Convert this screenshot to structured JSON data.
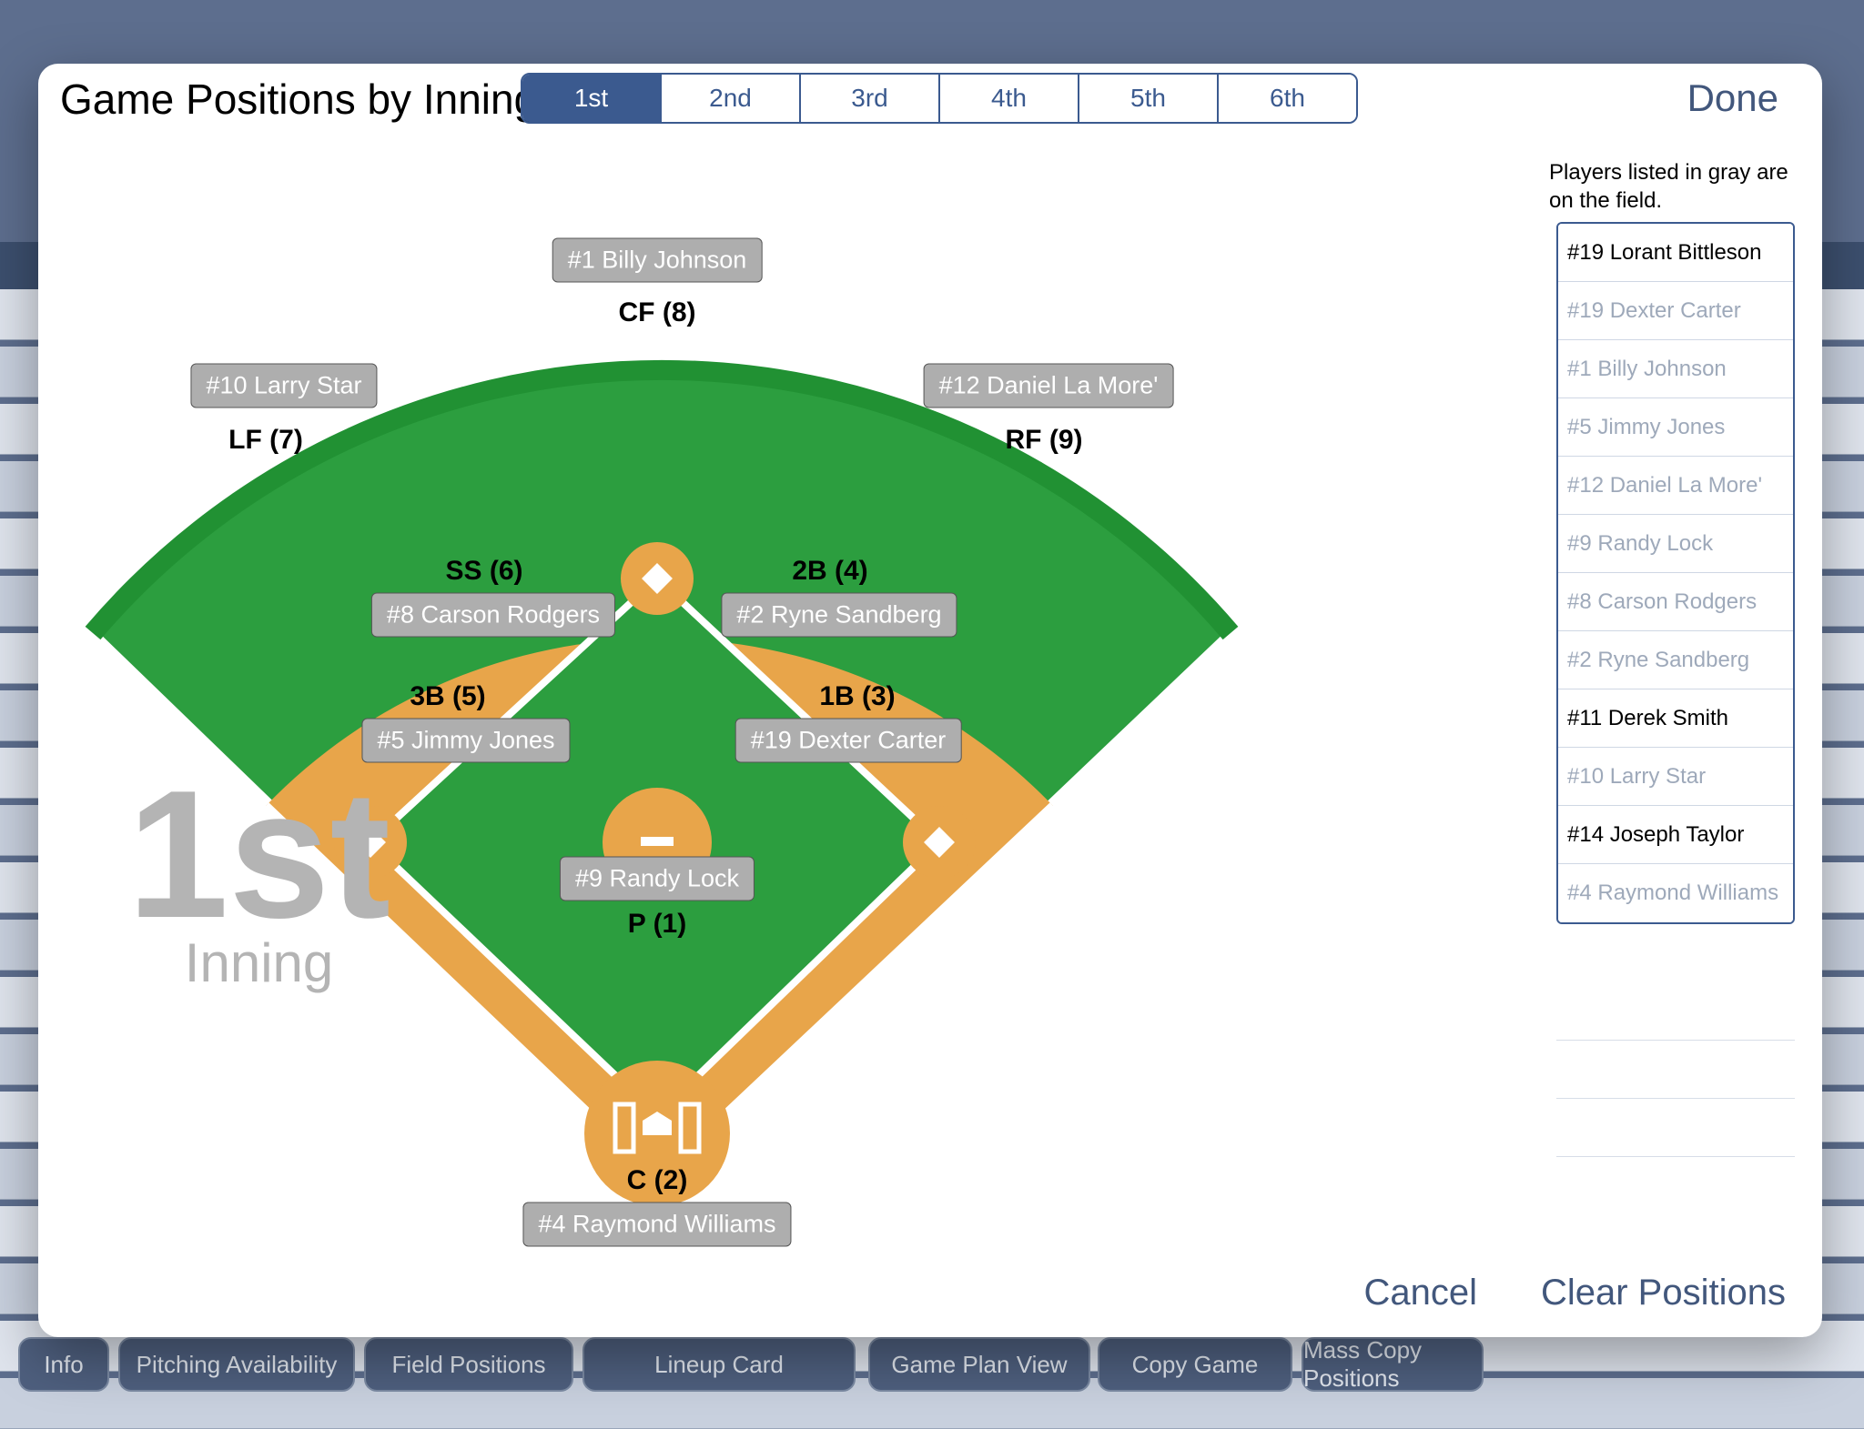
{
  "modal_title": "Game Positions by Inning",
  "done_label": "Done",
  "innings": [
    "1st",
    "2nd",
    "3rd",
    "4th",
    "5th",
    "6th"
  ],
  "active_inning_index": 0,
  "big_inning_num": "1st",
  "big_inning_word": "Inning",
  "helper_text": "Players listed in gray are on the field.",
  "positions": {
    "CF": {
      "label": "CF (8)",
      "player": "#1 Billy Johnson"
    },
    "LF": {
      "label": "LF (7)",
      "player": "#10 Larry Star"
    },
    "RF": {
      "label": "RF (9)",
      "player": "#12 Daniel La More'"
    },
    "SS": {
      "label": "SS (6)",
      "player": "#8 Carson Rodgers"
    },
    "2B": {
      "label": "2B (4)",
      "player": "#2 Ryne Sandberg"
    },
    "3B": {
      "label": "3B (5)",
      "player": "#5 Jimmy Jones"
    },
    "1B": {
      "label": "1B (3)",
      "player": "#19 Dexter Carter"
    },
    "P": {
      "label": "P (1)",
      "player": "#9 Randy Lock"
    },
    "C": {
      "label": "C (2)",
      "player": "#4 Raymond Williams"
    }
  },
  "roster": [
    {
      "name": "#19 Lorant Bittleson",
      "on_field": false
    },
    {
      "name": "#19 Dexter Carter",
      "on_field": true
    },
    {
      "name": "#1 Billy Johnson",
      "on_field": true
    },
    {
      "name": "#5 Jimmy Jones",
      "on_field": true
    },
    {
      "name": "#12 Daniel La More'",
      "on_field": true
    },
    {
      "name": "#9 Randy Lock",
      "on_field": true
    },
    {
      "name": "#8 Carson Rodgers",
      "on_field": true
    },
    {
      "name": "#2 Ryne Sandberg",
      "on_field": true
    },
    {
      "name": "#11 Derek Smith",
      "on_field": false
    },
    {
      "name": "#10 Larry Star",
      "on_field": true
    },
    {
      "name": "#14 Joseph Taylor",
      "on_field": false
    },
    {
      "name": "#4 Raymond Williams",
      "on_field": true
    }
  ],
  "actions": {
    "cancel": "Cancel",
    "clear": "Clear Positions"
  },
  "background_buttons": [
    "Info",
    "Pitching Availability",
    "Field Positions",
    "Lineup Card",
    "Game Plan View",
    "Copy Game",
    "Mass Copy Positions"
  ]
}
